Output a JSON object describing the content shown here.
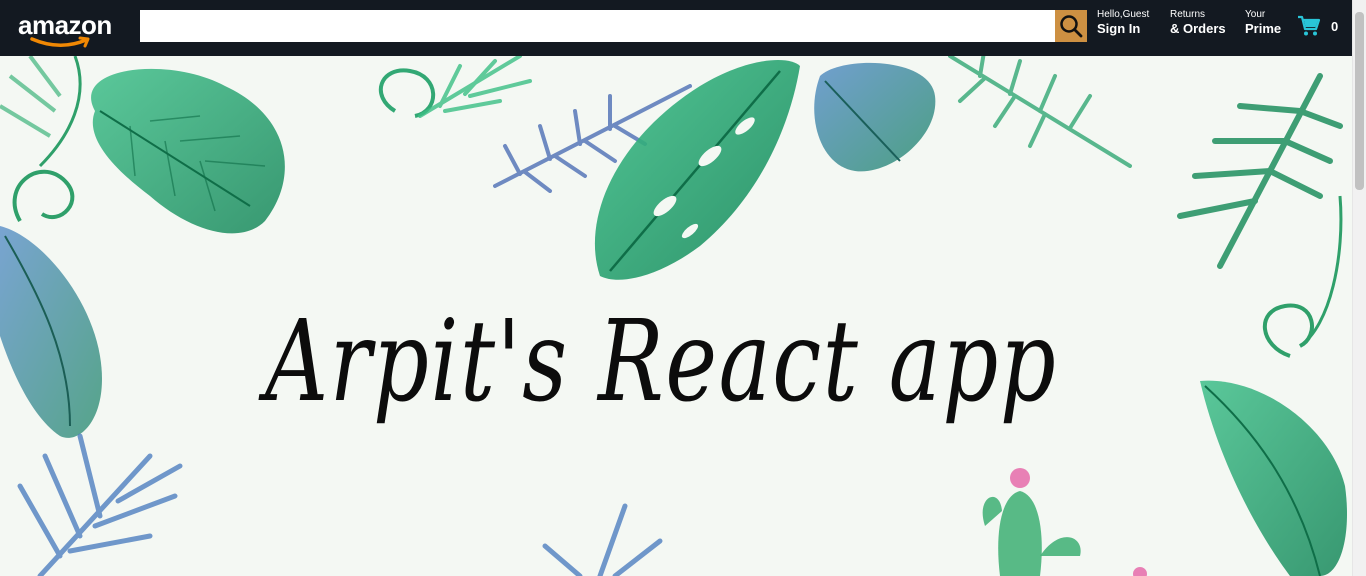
{
  "header": {
    "logo_text": "amazon",
    "search": {
      "value": "",
      "placeholder": ""
    },
    "account": {
      "line1": "Hello,Guest",
      "line2": "Sign In"
    },
    "orders": {
      "line1": "Returns",
      "line2": "& Orders"
    },
    "prime": {
      "line1": "Your",
      "line2": "Prime"
    },
    "basket": {
      "count": "0",
      "icon": "shopping-cart-icon"
    }
  },
  "hero": {
    "title": "Arpit's React app"
  },
  "colors": {
    "header_bg": "#131921",
    "search_button": "#cd9042",
    "cart_icon": "#29c5d8",
    "logo_smile": "#f08804",
    "hero_bg": "#f4f8f3"
  }
}
